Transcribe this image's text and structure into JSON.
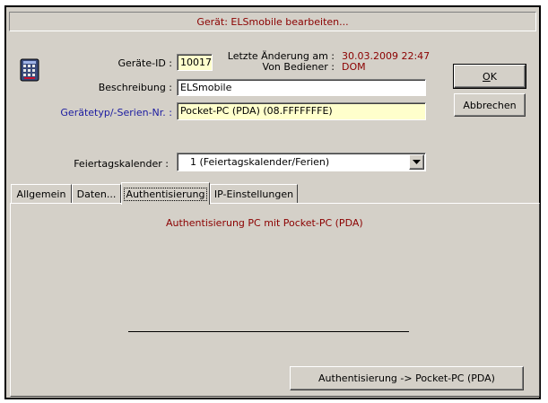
{
  "dialog": {
    "title": "Gerät: ELSmobile bearbeiten..."
  },
  "form": {
    "device_id_label": "Geräte-ID :",
    "device_id_value": "10017",
    "last_change_label": "Letzte Änderung am :",
    "last_change_value": "30.03.2009 22:47",
    "operator_label": "Von Bediener :",
    "operator_value": "DOM",
    "description_label": "Beschreibung :",
    "description_value": "ELSmobile",
    "device_type_label": "Gerätetyp/-Serien-Nr. :",
    "device_type_value": "Pocket-PC (PDA) (08.FFFFFFFE)",
    "holiday_calendar_label": "Feiertagskalender :",
    "holiday_calendar_value": "1 (Feiertagskalender/Ferien)"
  },
  "buttons": {
    "ok_label": "OK",
    "cancel_label": "Abbrechen",
    "auth_label": "Authentisierung -> Pocket-PC (PDA)"
  },
  "tabs": [
    {
      "label": "Allgemein"
    },
    {
      "label": "Daten..."
    },
    {
      "label": "Authentisierung"
    },
    {
      "label": "IP-Einstellungen"
    }
  ],
  "auth_panel": {
    "heading": "Authentisierung PC mit Pocket-PC (PDA)"
  },
  "colors": {
    "accent_red": "#8b0000",
    "link_blue": "#1a1aa0",
    "field_yellow": "#ffffcc",
    "dialog_gray": "#d4d0c8"
  },
  "icons": {
    "device": "pda-device-icon",
    "dropdown": "dropdown-arrow-icon"
  }
}
